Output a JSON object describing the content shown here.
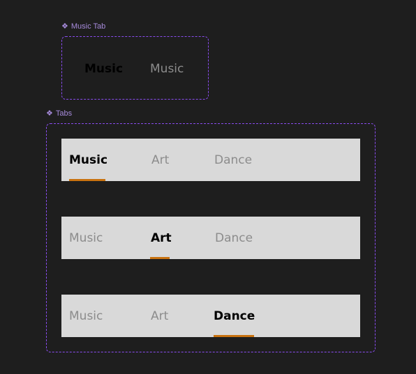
{
  "music_tab_component": {
    "label": "Music Tab",
    "icon": "component-icon",
    "variants": [
      {
        "label": "Music",
        "state": "active"
      },
      {
        "label": "Music",
        "state": "inactive"
      }
    ]
  },
  "tabs_component": {
    "label": "Tabs",
    "icon": "component-icon",
    "accent_color": "#c8720f",
    "rows": [
      {
        "tabs": [
          "Music",
          "Art",
          "Dance"
        ],
        "active": "Music"
      },
      {
        "tabs": [
          "Music",
          "Art",
          "Dance"
        ],
        "active": "Art"
      },
      {
        "tabs": [
          "Music",
          "Art",
          "Dance"
        ],
        "active": "Dance"
      }
    ]
  },
  "colors": {
    "background": "#1e1e1e",
    "frame_border": "#8a4cf0",
    "label": "#a78bdc",
    "tab_bar": "#d9d9d9",
    "active_text": "#000000",
    "inactive_text": "#8c8c8c"
  }
}
